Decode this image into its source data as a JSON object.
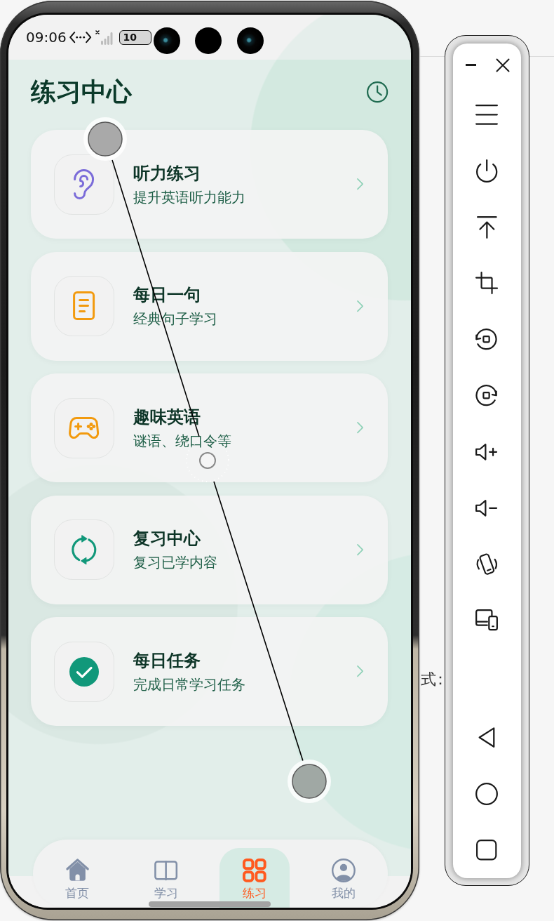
{
  "status_bar": {
    "time": "09:06",
    "battery": "10"
  },
  "header": {
    "title": "练习中心"
  },
  "cards": [
    {
      "title": "听力练习",
      "subtitle": "提升英语听力能力",
      "color": "#7b6cd9"
    },
    {
      "title": "每日一句",
      "subtitle": "经典句子学习",
      "color": "#f29a0e"
    },
    {
      "title": "趣味英语",
      "subtitle": "谜语、绕口令等",
      "color": "#f29a0e"
    },
    {
      "title": "复习中心",
      "subtitle": "复习已学内容",
      "color": "#11987a"
    },
    {
      "title": "每日任务",
      "subtitle": "完成日常学习任务",
      "color": "#11987a"
    }
  ],
  "bottom_nav": [
    {
      "label": "首页",
      "selected": false
    },
    {
      "label": "学习",
      "selected": false
    },
    {
      "label": "练习",
      "selected": true
    },
    {
      "label": "我的",
      "selected": false
    }
  ],
  "background_text": "式："
}
